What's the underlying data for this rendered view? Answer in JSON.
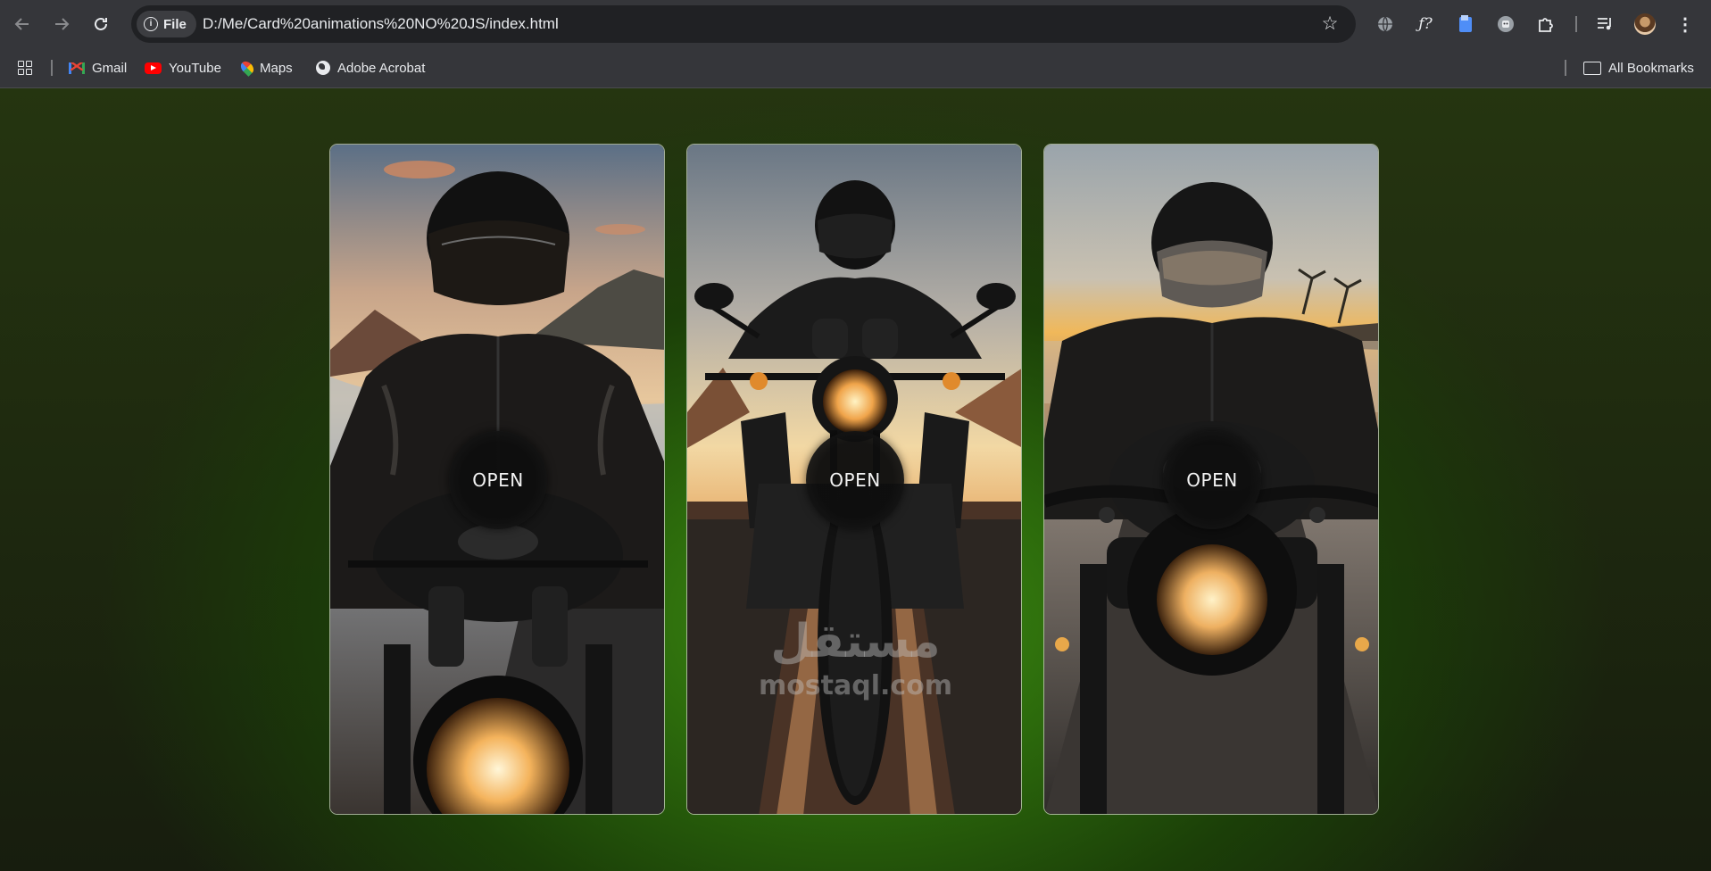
{
  "browser": {
    "tab_chip": "File",
    "url": "D:/Me/Card%20animations%20NO%20JS/index.html",
    "bookmarks": [
      {
        "label": "Gmail",
        "icon": "gmail-icon"
      },
      {
        "label": "YouTube",
        "icon": "youtube-icon"
      },
      {
        "label": "Maps",
        "icon": "maps-icon"
      },
      {
        "label": "Adobe Acrobat",
        "icon": "globe-icon"
      }
    ],
    "all_bookmarks": "All Bookmarks",
    "extension_icons": [
      "translate-icon",
      "formula-icon",
      "document-icon",
      "robot-icon",
      "puzzle-icon",
      "media-queue-icon",
      "profile-avatar",
      "more-menu-icon"
    ]
  },
  "cards": [
    {
      "button_label": "OPEN",
      "image": "rider-closeup-coastal-road-sunset"
    },
    {
      "button_label": "OPEN",
      "image": "rider-front-view-highway-sunset"
    },
    {
      "button_label": "OPEN",
      "image": "rider-reflective-visor-beach-sunset"
    }
  ],
  "watermark": {
    "arabic": "مستقل",
    "latin": "mostaql.com"
  },
  "colors": {
    "chrome_bg": "#35363a",
    "omnibox_bg": "#202124",
    "page_glow": "#3f8e12",
    "page_dark": "#13170e",
    "button_bg": "#0e0e0e"
  }
}
